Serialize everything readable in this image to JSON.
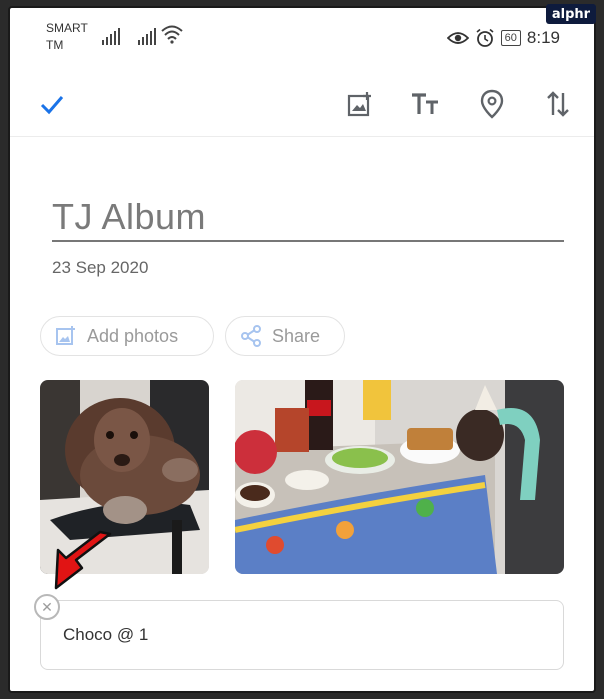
{
  "watermark": "alphr",
  "status": {
    "carrier_line1": "SMART",
    "carrier_line2": "TM",
    "battery": "60",
    "time": "8:19"
  },
  "toolbar": {
    "icons": [
      "check-icon",
      "add-photo-icon",
      "text-format-icon",
      "location-pin-icon",
      "sort-icon"
    ]
  },
  "album": {
    "title": "TJ Album",
    "date": "23 Sep 2020"
  },
  "actions": {
    "add_photos": "Add photos",
    "share": "Share"
  },
  "caption": {
    "value": "Choco @ 1"
  },
  "colors": {
    "accent": "#1a73e8",
    "arrow": "#e11414",
    "icon_gray": "#5f6368",
    "pill_icon": "#a7c4ef"
  }
}
